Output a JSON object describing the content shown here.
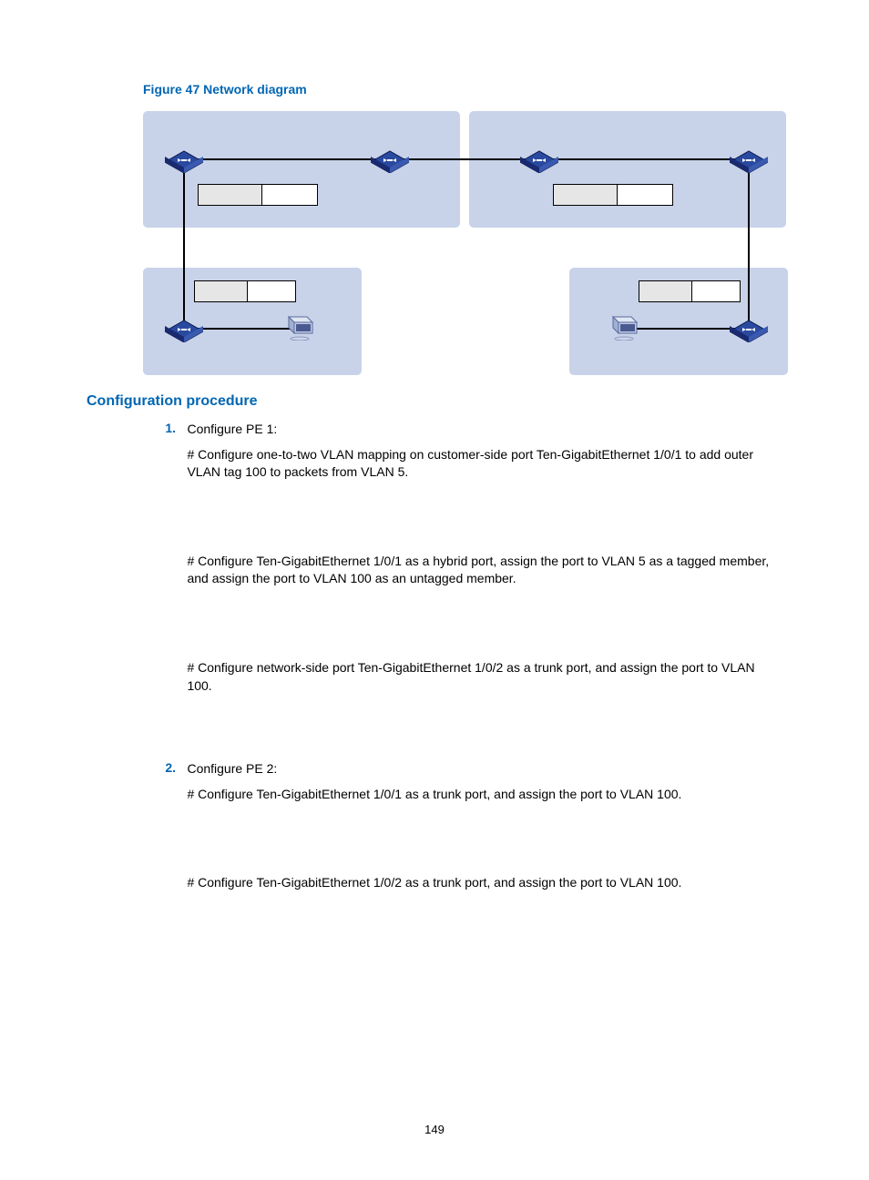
{
  "figure_caption": "Figure 47 Network diagram",
  "section_heading": "Configuration procedure",
  "items": [
    {
      "num": "1.",
      "title": "Configure PE 1:",
      "paras": [
        "# Configure one-to-two VLAN mapping on customer-side port Ten-GigabitEthernet 1/0/1 to add outer VLAN tag 100 to packets from VLAN 5.",
        "# Configure Ten-GigabitEthernet 1/0/1 as a hybrid port, assign the port to VLAN 5 as a tagged member, and assign the port to VLAN 100 as an untagged member.",
        "# Configure network-side port Ten-GigabitEthernet 1/0/2 as a trunk port, and assign the port to VLAN 100."
      ]
    },
    {
      "num": "2.",
      "title": "Configure PE 2:",
      "paras": [
        "# Configure Ten-GigabitEthernet 1/0/1 as a trunk port, and assign the port to VLAN 100.",
        "# Configure Ten-GigabitEthernet 1/0/2 as a trunk port, and assign the port to VLAN 100."
      ]
    }
  ],
  "page_number": "149"
}
